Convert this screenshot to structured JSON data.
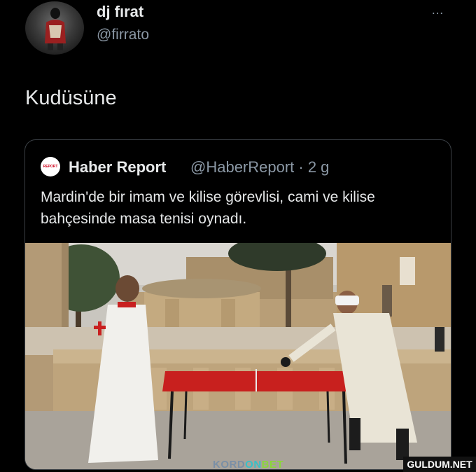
{
  "author": {
    "display_name": "dj fırat",
    "handle": "@firrato"
  },
  "more_icon": "…",
  "tweet": {
    "text": "Kudüsüne"
  },
  "quoted": {
    "logo_text": "REPORT",
    "display_name": "Haber Report",
    "handle_meta": "@HaberReport · 2 g",
    "text": "Mardin'de bir imam ve kilise görevlisi, cami ve kilise bahçesinde masa tenisi oynadı."
  },
  "watermarks": {
    "kordon_a": "KORD",
    "kordon_b": "ON",
    "kordon_c": "BET",
    "guldum": "GULDUM.NET"
  },
  "colors": {
    "background": "#000000",
    "text_primary": "#e7e9ea",
    "text_secondary": "#8b98a5",
    "card_border": "#3a3f44",
    "table_red": "#c8201e"
  }
}
